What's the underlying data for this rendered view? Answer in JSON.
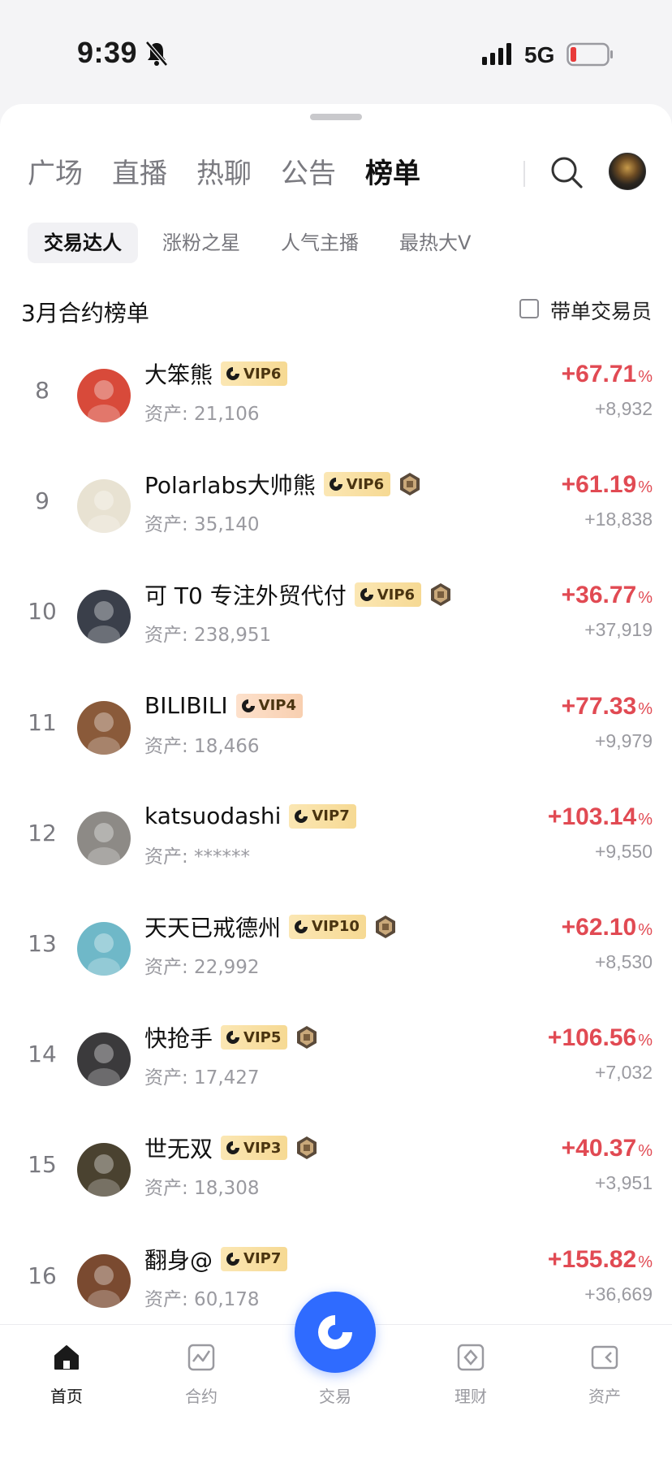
{
  "status_bar": {
    "time": "9:39",
    "network": "5G"
  },
  "top_tabs": [
    "广场",
    "直播",
    "热聊",
    "公告",
    "榜单"
  ],
  "active_top_tab": 4,
  "sub_tabs": [
    "交易达人",
    "涨粉之星",
    "人气主播",
    "最热大V"
  ],
  "active_sub_tab": 0,
  "section": {
    "title": "3月合约榜单",
    "filter_label": "带单交易员"
  },
  "rows": [
    {
      "rank": "8",
      "name": "大笨熊",
      "vip": "VIP6",
      "medal": false,
      "assets": "资产: 21,106",
      "pct": "+67.71",
      "unit": "%",
      "profit": "+8,932",
      "avatar_color": "#d84a3a"
    },
    {
      "rank": "9",
      "name": "Polarlabs大帅熊",
      "vip": "VIP6",
      "medal": true,
      "assets": "资产: 35,140",
      "pct": "+61.19",
      "unit": "%",
      "profit": "+18,838",
      "avatar_color": "#e8e2d2"
    },
    {
      "rank": "10",
      "name": "可 T0 专注外贸代付",
      "vip": "VIP6",
      "medal": true,
      "assets": "资产: 238,951",
      "pct": "+36.77",
      "unit": "%",
      "profit": "+37,919",
      "avatar_color": "#3a3f4a"
    },
    {
      "rank": "11",
      "name": "BILIBILI",
      "vip": "VIP4",
      "medal": false,
      "assets": "资产: 18,466",
      "pct": "+77.33",
      "unit": "%",
      "profit": "+9,979",
      "avatar_color": "#8a5a3a"
    },
    {
      "rank": "12",
      "name": "katsuodashi",
      "vip": "VIP7",
      "medal": false,
      "assets": "资产: ******",
      "pct": "+103.14",
      "unit": "%",
      "profit": "+9,550",
      "avatar_color": "#8d8a86"
    },
    {
      "rank": "13",
      "name": "天天已戒德州",
      "vip": "VIP10",
      "medal": true,
      "assets": "资产: 22,992",
      "pct": "+62.10",
      "unit": "%",
      "profit": "+8,530",
      "avatar_color": "#6fb8c8"
    },
    {
      "rank": "14",
      "name": "快抢手",
      "vip": "VIP5",
      "medal": true,
      "assets": "资产: 17,427",
      "pct": "+106.56",
      "unit": "%",
      "profit": "+7,032",
      "avatar_color": "#3b3a3c"
    },
    {
      "rank": "15",
      "name": "世无双",
      "vip": "VIP3",
      "medal": true,
      "assets": "资产: 18,308",
      "pct": "+40.37",
      "unit": "%",
      "profit": "+3,951",
      "avatar_color": "#4a4230"
    },
    {
      "rank": "16",
      "name": "翻身@",
      "vip": "VIP7",
      "medal": false,
      "assets": "资产: 60,178",
      "pct": "+155.82",
      "unit": "%",
      "profit": "+36,669",
      "avatar_color": "#7a4a30"
    }
  ],
  "bottom_nav": [
    "首页",
    "合约",
    "交易",
    "理财",
    "资产"
  ],
  "colors": {
    "positive": "#e14a53",
    "accent": "#2f6bff",
    "vip_gold": "#f6d993"
  }
}
